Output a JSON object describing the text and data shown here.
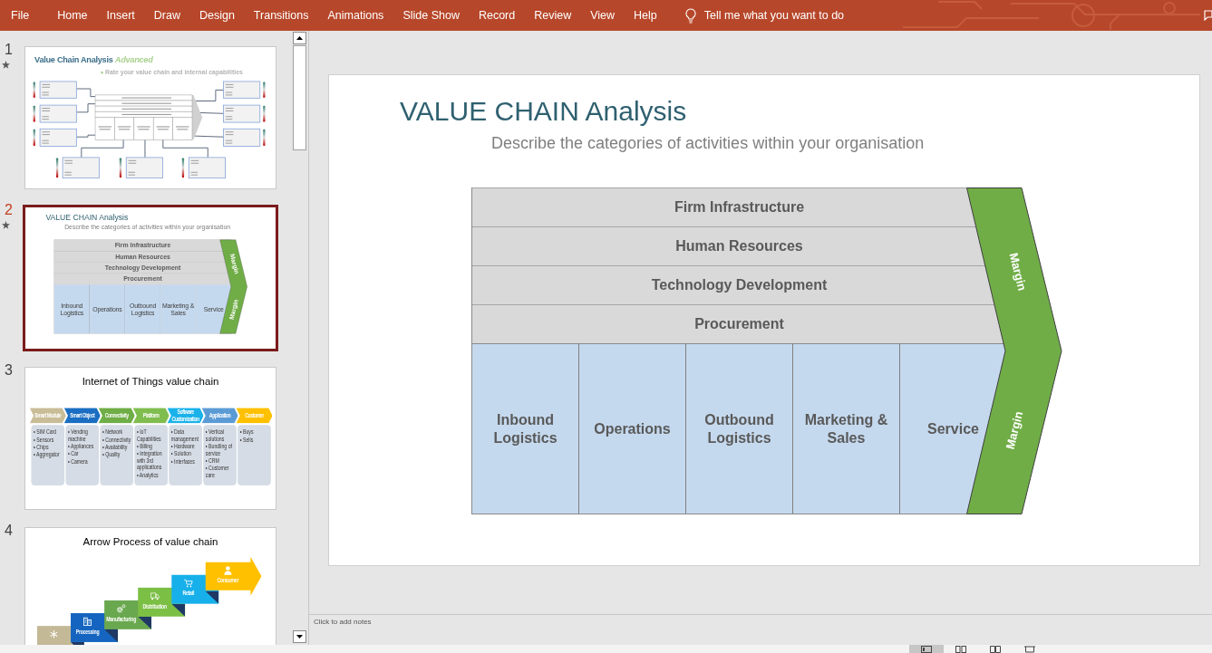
{
  "ribbon": {
    "tabs": [
      "File",
      "Home",
      "Insert",
      "Draw",
      "Design",
      "Transitions",
      "Animations",
      "Slide Show",
      "Record",
      "Review",
      "View",
      "Help"
    ],
    "tell_me": "Tell me what you want to do"
  },
  "thumbnails": [
    {
      "number": "1",
      "kind": "fishbone",
      "selected": false,
      "animated": true,
      "title": "Value Chain Analysis *Advanced*",
      "subtitle": "Rate your value chain and internal capabilities"
    },
    {
      "number": "2",
      "kind": "value_chain",
      "selected": true,
      "animated": true,
      "title": "VALUE CHAIN Analysis",
      "subtitle": "Describe the categories of activities within your organisation",
      "support_activities": [
        "Firm Infrastructure",
        "Human Resources",
        "Technology Development",
        "Procurement"
      ],
      "primary_activities": [
        "Inbound Logistics",
        "Operations",
        "Outbound Logistics",
        "Marketing & Sales",
        "Service"
      ],
      "margin_labels": [
        "Margin",
        "Margin"
      ]
    },
    {
      "number": "3",
      "kind": "stages",
      "selected": false,
      "animated": false,
      "title": "Internet of Things value chain",
      "stages": [
        {
          "label": "Smart Module",
          "color": "#c9bd98",
          "bullets": [
            "• SIM Card",
            "• Sensors",
            "• Chips",
            "• Aggregator"
          ]
        },
        {
          "label": "Smart Object",
          "color": "#1b6ec2",
          "bullets": [
            "• Vending machine",
            "• Appliances",
            "• Car",
            "• Camera"
          ]
        },
        {
          "label": "Connectivity",
          "color": "#6fad46",
          "bullets": [
            "• Network",
            "• Connectivity",
            "• Availability",
            "• Quality"
          ]
        },
        {
          "label": "Platform",
          "color": "#80bd4f",
          "bullets": [
            "• IoT Capabilities",
            "• Billing",
            "• Integration with 3rd applications",
            "• Analytics"
          ]
        },
        {
          "label": "Software Customization",
          "color": "#1ab2ea",
          "bullets": [
            "• Data management",
            "• Hardware",
            "• Solution",
            "• Interfaces"
          ]
        },
        {
          "label": "Application",
          "color": "#5b9bd5",
          "bullets": [
            "• Vertical solutions",
            "• Bundling of service",
            "• CRM",
            "• Customer care"
          ]
        },
        {
          "label": "Customer",
          "color": "#ffc000",
          "bullets": [
            "• Buys",
            "• Sells"
          ]
        }
      ]
    },
    {
      "number": "4",
      "kind": "steps",
      "selected": false,
      "animated": false,
      "title": "Arrow Process of value chain",
      "steps": [
        {
          "kind": "asterisk",
          "color": "#c4b996"
        },
        {
          "kind": "building",
          "label": "Processing",
          "color": "#1565c0"
        },
        {
          "kind": "gears",
          "label": "Manufacturing",
          "color": "#6aa84f"
        },
        {
          "kind": "truck",
          "label": "Distribution",
          "color": "#7cbf45"
        },
        {
          "kind": "cart",
          "label": "Retail",
          "color": "#17b0ea"
        },
        {
          "kind": "person",
          "label": "Consumer",
          "color": "#ffc000"
        }
      ]
    }
  ],
  "slide": {
    "title": "VALUE CHAIN Analysis",
    "subtitle": "Describe the categories of activities within your organisation",
    "support_activities": [
      "Firm Infrastructure",
      "Human Resources",
      "Technology Development",
      "Procurement"
    ],
    "primary_activities": [
      "Inbound Logistics",
      "Operations",
      "Outbound Logistics",
      "Marketing & Sales",
      "Service"
    ],
    "margin_labels": [
      "Margin",
      "Margin"
    ]
  },
  "notes": {
    "placeholder": "Click to add notes"
  },
  "status_bar": {
    "view_buttons": [
      {
        "kind": "normal",
        "selected": true
      },
      {
        "kind": "sorter",
        "selected": false
      },
      {
        "kind": "reading",
        "selected": false
      },
      {
        "kind": "slideshow",
        "selected": false
      }
    ]
  }
}
